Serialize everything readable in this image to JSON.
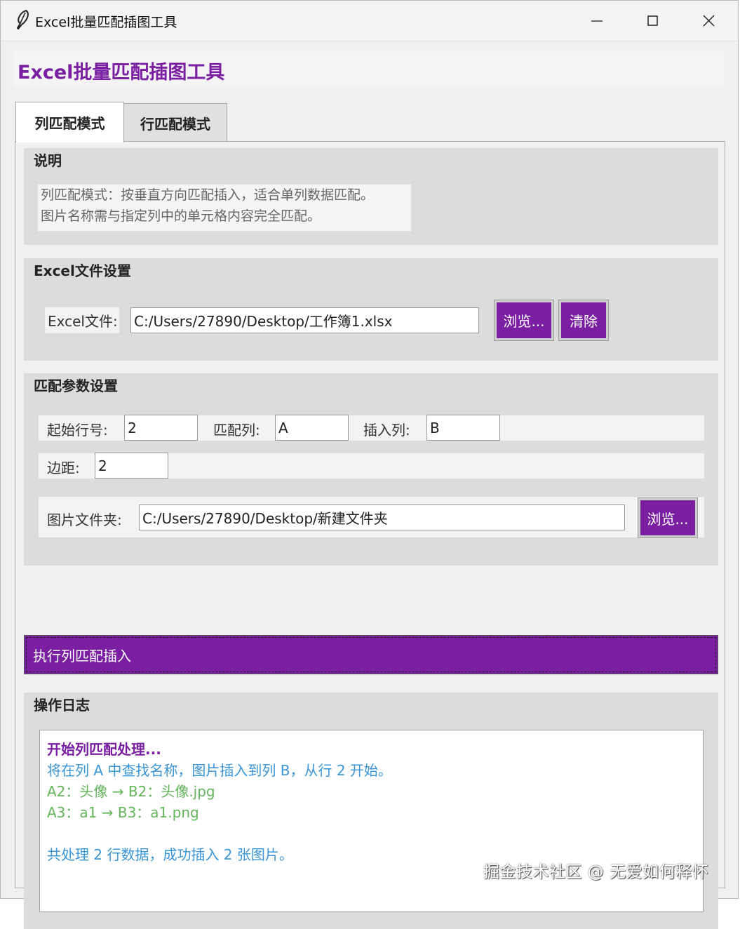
{
  "window": {
    "title": "Excel批量匹配插图工具",
    "controls": [
      "minimize",
      "maximize",
      "close"
    ]
  },
  "app": {
    "heading": "Excel批量匹配插图工具",
    "accent_color": "#7b1fa2"
  },
  "tabs": [
    {
      "label": "列匹配模式",
      "active": true
    },
    {
      "label": "行匹配模式",
      "active": false
    }
  ],
  "description": {
    "title": "说明",
    "lines": [
      "列匹配模式：按垂直方向匹配插入，适合单列数据匹配。",
      "图片名称需与指定列中的单元格内容完全匹配。"
    ]
  },
  "excel_settings": {
    "title": "Excel文件设置",
    "file_label": "Excel文件:",
    "file_value": "C:/Users/27890/Desktop/工作簿1.xlsx",
    "browse_label": "浏览...",
    "clear_label": "清除"
  },
  "match_params": {
    "title": "匹配参数设置",
    "start_row_label": "起始行号:",
    "start_row_value": "2",
    "match_col_label": "匹配列:",
    "match_col_value": "A",
    "insert_col_label": "插入列:",
    "insert_col_value": "B",
    "margin_label": "边距:",
    "margin_value": "2",
    "folder_label": "图片文件夹:",
    "folder_value": "C:/Users/27890/Desktop/新建文件夹",
    "browse_label": "浏览..."
  },
  "execute": {
    "label": "执行列匹配插入"
  },
  "log": {
    "title": "操作日志",
    "lines": [
      {
        "text": "开始列匹配处理...",
        "kind": "head"
      },
      {
        "text": "将在列 A 中查找名称，图片插入到列 B，从行 2 开始。",
        "kind": "info"
      },
      {
        "text": "A2：头像 → B2：头像.jpg",
        "kind": "ok"
      },
      {
        "text": "A3：a1 → B3：a1.png",
        "kind": "ok"
      },
      {
        "text": "",
        "kind": "blank"
      },
      {
        "text": "共处理 2 行数据，成功插入 2 张图片。",
        "kind": "info"
      }
    ]
  },
  "watermark": "掘金技术社区 @ 无爱如何释怀"
}
